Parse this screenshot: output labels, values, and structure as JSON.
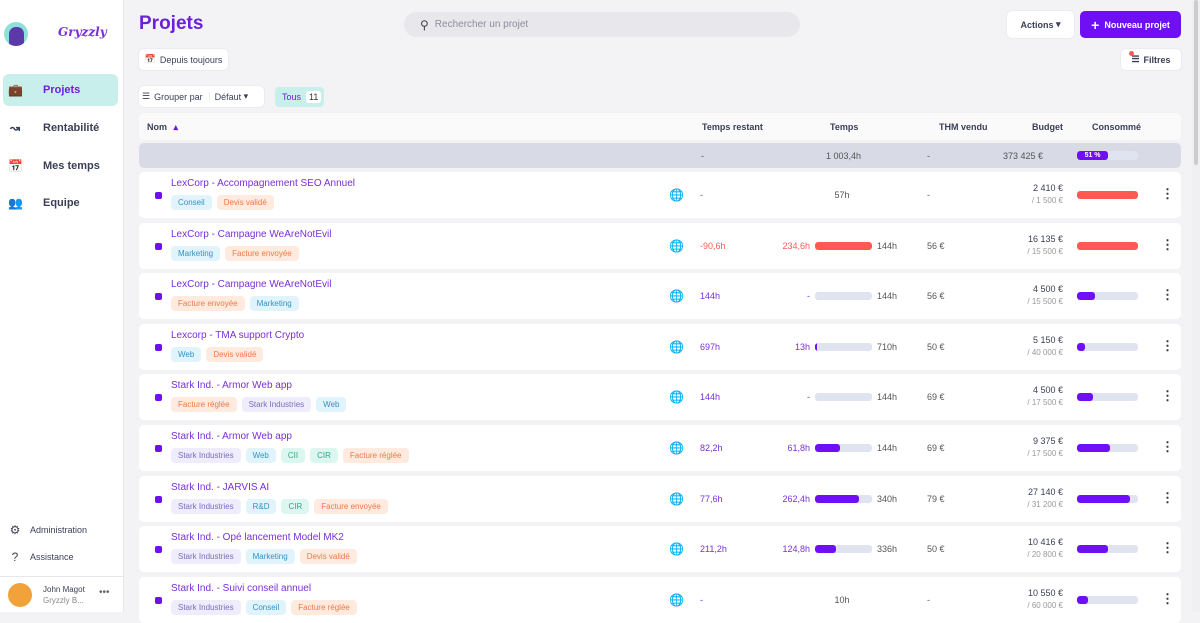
{
  "brand": "Gryzzly",
  "sidebar": {
    "items": [
      {
        "label": "Projets",
        "icon": "briefcase-icon"
      },
      {
        "label": "Rentabilité",
        "icon": "chart-icon"
      },
      {
        "label": "Mes temps",
        "icon": "calendar-icon"
      },
      {
        "label": "Equipe",
        "icon": "team-icon"
      }
    ],
    "admin": "Administration",
    "help": "Assistance",
    "user": {
      "name": "John Magot",
      "org": "Gryzzly B..."
    }
  },
  "header": {
    "title": "Projets",
    "search_placeholder": "Rechercher un projet",
    "actions": "Actions",
    "new_project": "Nouveau projet",
    "filters": "Filtres",
    "period": "Depuis toujours",
    "group_by": "Grouper par",
    "group_value": "Défaut",
    "all": "Tous",
    "all_count": "11"
  },
  "columns": {
    "name": "Nom",
    "remaining": "Temps restant",
    "time": "Temps",
    "thm": "THM vendu",
    "budget": "Budget",
    "consumed": "Consommé"
  },
  "totals": {
    "remaining": "-",
    "time": "1 003,4h",
    "thm": "-",
    "budget": "373 425 €",
    "consumed": "51 %",
    "consumed_value": 0.51
  },
  "colors": {
    "accent": "#6f0ff5",
    "danger": "#ff5a52"
  },
  "rows": [
    {
      "name": "LexCorp - Accompagnement SEO Annuel",
      "tags": [
        [
          "Conseil",
          "blue"
        ],
        [
          "Devis validé",
          "orange"
        ]
      ],
      "remaining": "-",
      "spent": "",
      "total": "57h",
      "time_fill": null,
      "thm": "-",
      "budget": "2 410 €",
      "budget_of": "/ 1 500 €",
      "consumed": 1,
      "over": true
    },
    {
      "name": "LexCorp - Campagne WeAreNotEvil",
      "tags": [
        [
          "Marketing",
          "blue"
        ],
        [
          "Facture envoyée",
          "orange"
        ]
      ],
      "remaining": "-90,6h",
      "spent": "234,6h",
      "total": "144h",
      "time_fill": 1,
      "thm": "56 €",
      "budget": "16 135 €",
      "budget_of": "/ 15 500 €",
      "consumed": 1,
      "over": true
    },
    {
      "name": "LexCorp - Campagne WeAreNotEvil",
      "tags": [
        [
          "Facture envoyée",
          "orange"
        ],
        [
          "Marketing",
          "blue"
        ]
      ],
      "remaining": "144h",
      "spent": "-",
      "total": "144h",
      "time_fill": 0,
      "thm": "56 €",
      "budget": "4 500 €",
      "budget_of": "/ 15 500 €",
      "consumed": 0.29,
      "over": false
    },
    {
      "name": "Lexcorp - TMA support Crypto",
      "tags": [
        [
          "Web",
          "blue"
        ],
        [
          "Devis validé",
          "orange"
        ]
      ],
      "remaining": "697h",
      "spent": "13h",
      "total": "710h",
      "time_fill": 0.02,
      "thm": "50 €",
      "budget": "5 150 €",
      "budget_of": "/ 40 000 €",
      "consumed": 0.13,
      "over": false
    },
    {
      "name": "Stark Ind. - Armor Web app",
      "tags": [
        [
          "Facture réglée",
          "orange"
        ],
        [
          "Stark Industries",
          "purple"
        ],
        [
          "Web",
          "blue"
        ]
      ],
      "remaining": "144h",
      "spent": "-",
      "total": "144h",
      "time_fill": 0,
      "thm": "69 €",
      "budget": "4 500 €",
      "budget_of": "/ 17 500 €",
      "consumed": 0.26,
      "over": false
    },
    {
      "name": "Stark Ind. - Armor Web app",
      "tags": [
        [
          "Stark Industries",
          "purple"
        ],
        [
          "Web",
          "blue"
        ],
        [
          "CII",
          "teal"
        ],
        [
          "CIR",
          "teal"
        ],
        [
          "Facture réglée",
          "orange"
        ]
      ],
      "remaining": "82,2h",
      "spent": "61,8h",
      "total": "144h",
      "time_fill": 0.43,
      "thm": "69 €",
      "budget": "9 375 €",
      "budget_of": "/ 17 500 €",
      "consumed": 0.54,
      "over": false
    },
    {
      "name": "Stark Ind. - JARVIS AI",
      "tags": [
        [
          "Stark Industries",
          "purple"
        ],
        [
          "R&D",
          "blue"
        ],
        [
          "CIR",
          "teal"
        ],
        [
          "Facture envoyée",
          "orange"
        ]
      ],
      "remaining": "77,6h",
      "spent": "262,4h",
      "total": "340h",
      "time_fill": 0.77,
      "thm": "79 €",
      "budget": "27 140 €",
      "budget_of": "/ 31 200 €",
      "consumed": 0.87,
      "over": false
    },
    {
      "name": "Stark Ind. - Opé lancement Model MK2",
      "tags": [
        [
          "Stark Industries",
          "purple"
        ],
        [
          "Marketing",
          "blue"
        ],
        [
          "Devis validé",
          "orange"
        ]
      ],
      "remaining": "211,2h",
      "spent": "124,8h",
      "total": "336h",
      "time_fill": 0.37,
      "thm": "50 €",
      "budget": "10 416 €",
      "budget_of": "/ 20 800 €",
      "consumed": 0.5,
      "over": false
    },
    {
      "name": "Stark Ind. - Suivi conseil annuel",
      "tags": [
        [
          "Stark Industries",
          "purple"
        ],
        [
          "Conseil",
          "blue"
        ],
        [
          "Facture réglée",
          "orange"
        ]
      ],
      "remaining": "-",
      "spent": "",
      "total": "10h",
      "time_fill": null,
      "thm": "-",
      "budget": "10 550 €",
      "budget_of": "/ 60 000 €",
      "consumed": 0.18,
      "over": false
    }
  ]
}
